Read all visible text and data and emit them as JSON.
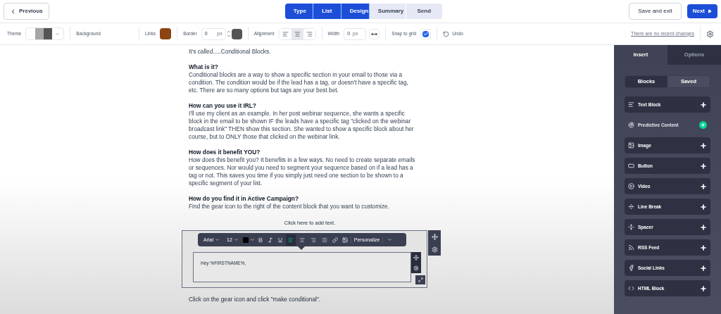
{
  "header": {
    "previous": "Previous",
    "steps": [
      {
        "label": "Type",
        "completed": true
      },
      {
        "label": "List",
        "completed": true
      },
      {
        "label": "Design",
        "completed": true
      },
      {
        "label": "Summary",
        "completed": false
      },
      {
        "label": "Send",
        "completed": false
      }
    ],
    "save": "Save and exit",
    "next": "Next"
  },
  "toolbar": {
    "theme": {
      "label": "Theme",
      "swatches": [
        {
          "color": "#ffffff"
        },
        {
          "color": "#a6a6a6"
        },
        {
          "color": "#555555"
        }
      ]
    },
    "background": {
      "label": "Background"
    },
    "links": {
      "label": "Links",
      "color": "#8b4513"
    },
    "border": {
      "label": "Border",
      "value": "0",
      "unit": "px",
      "color": "#555555"
    },
    "alignment": {
      "label": "Alignment",
      "options": [
        {
          "selected": false
        },
        {
          "selected": true
        },
        {
          "selected": false
        }
      ]
    },
    "width": {
      "label": "Width",
      "value": "0",
      "unit": "px"
    },
    "snap": {
      "label": "Snap to grid",
      "checked": true
    },
    "undo": "Undo",
    "changes": "There are no recent changes"
  },
  "content": {
    "intro": "It's called.....Conditional Blocks.",
    "sections": [
      {
        "heading": "What is it?",
        "body": "Conditional blocks are a way to show a specific section in your email to those via a condition. The condition would be if the lead has a tag, or doesn't have a specific tag, etc. There are so many options but tags are your best bet."
      },
      {
        "heading": "How can you use it IRL?",
        "body": "I'll use my client as an example. In her post webinar sequence, she wants a specific block in the email to be shown IF the leads have a specific tag \"clicked on the webinar broadcast link\" THEN show this section. She wanted to show a specific block about her course, but to ONLY those that clicked on the webinar link."
      },
      {
        "heading": "How does it benefit YOU?",
        "body": "How does this benefit you? It benefits in a few ways. No need to create separate emails or sequences. Nor would you need to segment your sequence based on if a lead has a tag or not. This saves you time if you simply just need one section to be shown to a specific segment of your list."
      },
      {
        "heading": "How do you find it in Active Campaign?",
        "body": "Find the gear icon to the right of the content block that you want to customize."
      }
    ],
    "add_text": "Click here to add text.",
    "editor": {
      "font": "Arial",
      "size": "12",
      "color": "#000000",
      "align": [
        {
          "selected": true
        },
        {
          "selected": false
        },
        {
          "selected": false
        },
        {
          "selected": false
        }
      ],
      "personalize": "Personalize",
      "text": "Hey %FIRSTNAME%,"
    },
    "after": "Click on the gear icon and click \"make conditional\"."
  },
  "sidebar": {
    "tabs": [
      {
        "label": "Insert",
        "selected": true
      },
      {
        "label": "Options",
        "selected": false
      }
    ],
    "subtabs": [
      {
        "label": "Blocks",
        "selected": true
      },
      {
        "label": "Saved",
        "selected": false
      }
    ],
    "items": [
      {
        "label": "Text Block",
        "kind": "block"
      },
      {
        "label": "Predictive Content",
        "kind": "feature"
      },
      {
        "label": "Image",
        "kind": "block"
      },
      {
        "label": "Button",
        "kind": "block"
      },
      {
        "label": "Video",
        "kind": "block"
      },
      {
        "label": "Line Break",
        "kind": "block"
      },
      {
        "label": "Spacer",
        "kind": "block"
      },
      {
        "label": "RSS Feed",
        "kind": "block"
      },
      {
        "label": "Social Links",
        "kind": "block"
      },
      {
        "label": "HTML Block",
        "kind": "block"
      }
    ]
  }
}
